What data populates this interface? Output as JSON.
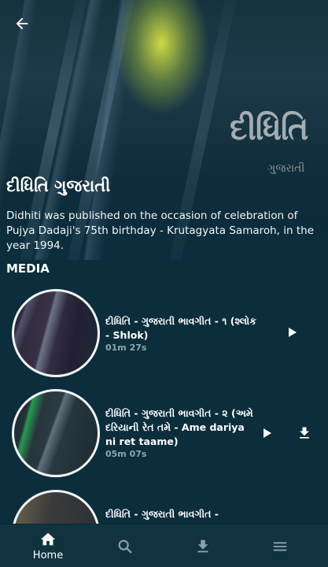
{
  "header": {
    "back_icon": "arrow-left-icon",
    "cover_logo": "દીધિતિ",
    "cover_subtitle": "ગુજરાતી"
  },
  "album": {
    "title": "દીધિતિ ગુજરાતી",
    "description": "Didhiti was published on the occasion of celebration of Pujya Dadaji's 75th birthday - Krutagyata  Samaroh, in the year 1994."
  },
  "media": {
    "section_label": "MEDIA",
    "items": [
      {
        "title": "દીધિતિ - ગુજરાતી ભાવગીત - ૧ (શ્લોક - Shlok)",
        "duration": "01m 27s",
        "play_icon": "play-icon",
        "download_icon": null
      },
      {
        "title": "દીધિતિ - ગુજરાતી ભાવગીત - ૨ (અમે દરિયાની રેત તમે - Ame dariya ni ret taame)",
        "duration": "05m 07s",
        "play_icon": "play-icon",
        "download_icon": "download-icon"
      },
      {
        "title": "દીધિતિ - ગુજરાતી ભાવગીત -",
        "duration": "",
        "play_icon": null,
        "download_icon": null
      }
    ]
  },
  "bottom_nav": {
    "items": [
      {
        "label": "Home",
        "icon": "home-icon",
        "active": true
      },
      {
        "label": "",
        "icon": "search-icon",
        "active": false
      },
      {
        "label": "",
        "icon": "download-icon",
        "active": false
      },
      {
        "label": "",
        "icon": "menu-icon",
        "active": false
      }
    ]
  },
  "colors": {
    "background": "#0b2d3c",
    "nav_background": "#11333f",
    "text": "#ffffff",
    "muted": "#8fa6b0"
  }
}
